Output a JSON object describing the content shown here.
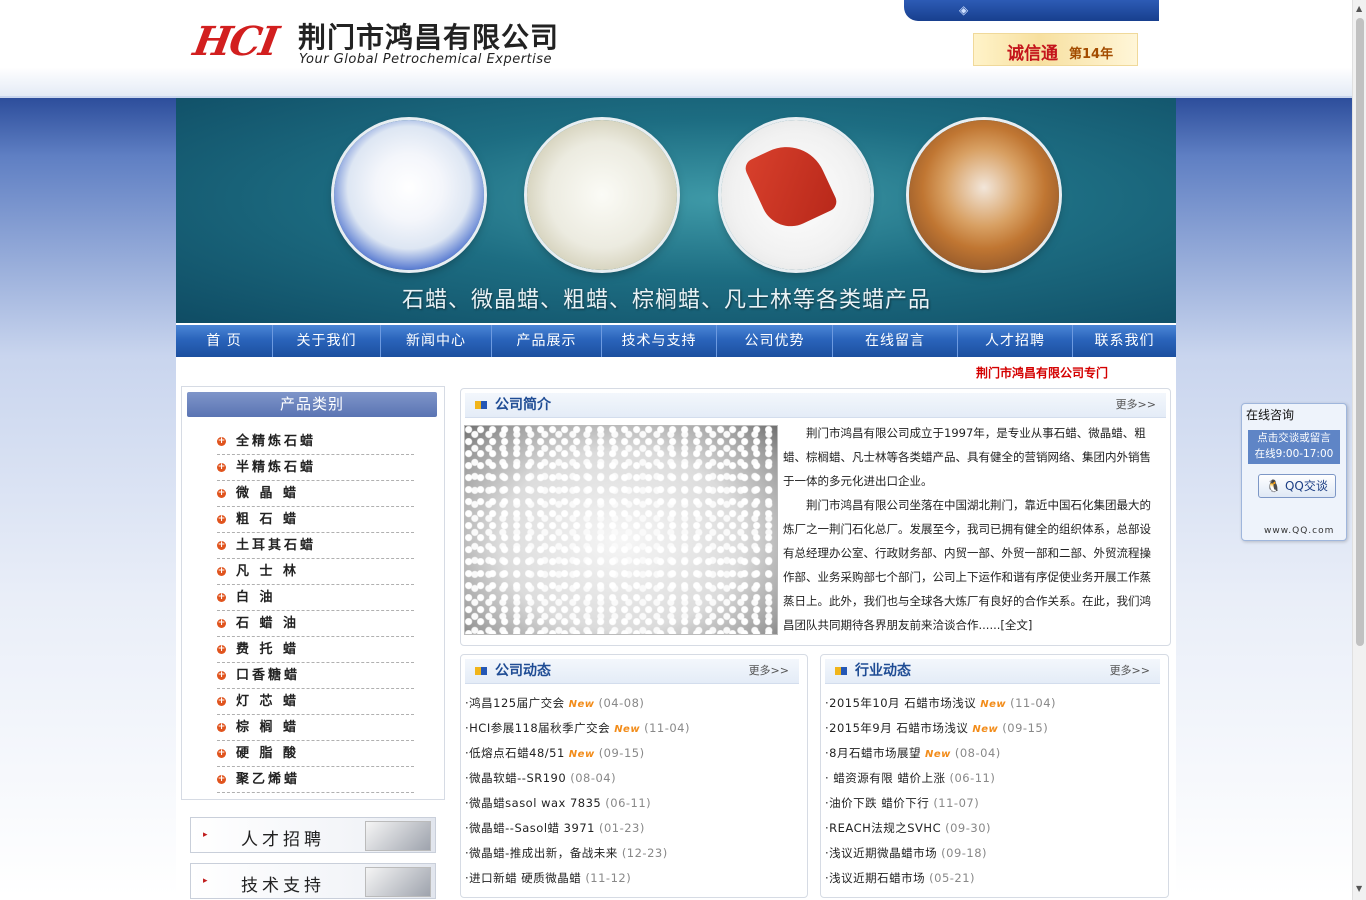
{
  "header": {
    "logo_mark": "HCI",
    "company_cn": "荆门市鸿昌有限公司",
    "company_en": "Your Global Petrochemical Expertise",
    "chengxin_logo": "诚信通",
    "chengxin_years": "第14年"
  },
  "banner": {
    "caption": "石蜡、微晶蜡、粗蜡、棕榈蜡、凡士林等各类蜡产品"
  },
  "nav": {
    "items": [
      "首  页",
      "关于我们",
      "新闻中心",
      "产品展示",
      "技术与支持",
      "公司优势",
      "在线留言",
      "人才招聘",
      "联系我们"
    ]
  },
  "marquee": "荆门市鸿昌有限公司专门",
  "categories": {
    "title": "产品类别",
    "items": [
      "全精炼石蜡",
      "半精炼石蜡",
      "微 晶 蜡",
      "粗 石 蜡",
      "土耳其石蜡",
      "凡 士 林",
      "白 油",
      "石 蜡 油",
      "费 托 蜡",
      "口香糖蜡",
      "灯 芯 蜡",
      "棕 榈 蜡",
      "硬 脂 酸",
      "聚乙烯蜡"
    ]
  },
  "side_buttons": {
    "recruit": "人才招聘",
    "support": "技术支持"
  },
  "intro": {
    "title": "公司简介",
    "more": "更多>>",
    "para1": "荆门市鸿昌有限公司成立于1997年，是专业从事石蜡、微晶蜡、粗蜡、棕榈蜡、凡士林等各类蜡产品、具有健全的营销网络、集团内外销售于一体的多元化进出口企业。",
    "para2": "荆门市鸿昌有限公司坐落在中国湖北荆门，靠近中国石化集团最大的炼厂之一荆门石化总厂。发展至今，我司已拥有健全的组织体系，总部设有总经理办公室、行政财务部、内贸一部、外贸一部和二部、外贸流程操作部、业务采购部七个部门，公司上下运作和谐有序促使业务开展工作蒸蒸日上。此外，我们也与全球各大炼厂有良好的合作关系。在此，我们鸿昌团队共同期待各界朋友前来洽谈合作......[全文]"
  },
  "company_news": {
    "title": "公司动态",
    "more": "更多>>",
    "items": [
      {
        "text": "·鸿昌125届广交会",
        "new": "New",
        "date": "(04-08)"
      },
      {
        "text": "·HCI参展118届秋季广交会",
        "new": "New",
        "date": "(11-04)"
      },
      {
        "text": "·低熔点石蜡48/51",
        "new": "New",
        "date": "(09-15)"
      },
      {
        "text": "·微晶软蜡--SR190",
        "new": "",
        "date": "(08-04)"
      },
      {
        "text": "·微晶蜡sasol wax 7835",
        "new": "",
        "date": "(06-11)"
      },
      {
        "text": "·微晶蜡--Sasol蜡 3971",
        "new": "",
        "date": "(01-23)"
      },
      {
        "text": "·微晶蜡-推成出新，备战未来",
        "new": "",
        "date": "(12-23)"
      },
      {
        "text": "·进口新蜡 硬质微晶蜡",
        "new": "",
        "date": "(11-12)"
      }
    ]
  },
  "industry_news": {
    "title": "行业动态",
    "more": "更多>>",
    "items": [
      {
        "text": "·2015年10月 石蜡市场浅议",
        "new": "New",
        "date": "(11-04)"
      },
      {
        "text": "·2015年9月 石蜡市场浅议",
        "new": "New",
        "date": "(09-15)"
      },
      {
        "text": "·8月石蜡市场展望",
        "new": "New",
        "date": "(08-04)"
      },
      {
        "text": "· 蜡资源有限 蜡价上涨",
        "new": "",
        "date": "(06-11)"
      },
      {
        "text": "·油价下跌 蜡价下行",
        "new": "",
        "date": "(11-07)"
      },
      {
        "text": "·REACH法规之SVHC",
        "new": "",
        "date": "(09-30)"
      },
      {
        "text": "·浅议近期微晶蜡市场",
        "new": "",
        "date": "(09-18)"
      },
      {
        "text": "·浅议近期石蜡市场",
        "new": "",
        "date": "(05-21)"
      }
    ]
  },
  "qq_widget": {
    "title": "在线咨询",
    "note_line1": "点击交谈或留言",
    "note_line2": "在线9:00-17:00",
    "button": "QQ交谈",
    "url": "www.QQ.com"
  },
  "colors": {
    "nav_blue": "#2a64bb",
    "accent_red": "#d40000",
    "new_orange": "#f28c1a"
  }
}
